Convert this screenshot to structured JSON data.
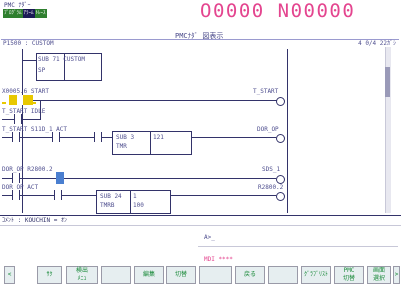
{
  "header": {
    "top_label": "PMC ﾅﾀﾞｰ",
    "tab_a": "ﾌﾟﾛｸﾞﾗﾑ",
    "tab_b": "ｱﾗｰﾑ",
    "tab_c": "ﾄﾚｰｽ",
    "mode_title": "PMCﾅﾀﾞ 図表示",
    "counter": "O0000 N00000"
  },
  "status_bar": {
    "program": "P1500 : CUSTOM",
    "position": "4 0/4 22ｶﾞｼ"
  },
  "ladder": {
    "rung1_func": "SUB 71 CUSTOM",
    "rung1_sub": "SP",
    "rung2_contact": "X0005.6 START",
    "rung2_coil": "T_START",
    "rung3_contact": "T_START IDLE",
    "rung4_contacts": "T_START S11D_1  ACT",
    "rung4_func_a": "SUB 3",
    "rung4_func_b": "TMR",
    "rung4_func_c": "121",
    "rung4_coil": "DOR_OP",
    "rung5_contact": "DOR_OP  R2800.2",
    "rung5_coil": "SDS_1",
    "rung6_contact": "DOR_OP  ACT",
    "rung6_func_a": "SUB 24",
    "rung6_func_b": "TMRB",
    "rung6_func_c": "1",
    "rung6_func_d": "100",
    "rung6_coil": "R2800.2"
  },
  "footer": {
    "comment_line": "ｺﾒﾝﾄ : KOUCHIN = ｵﾝ",
    "input_prompt": "A>_",
    "mode_line": "MDI ****"
  },
  "softkeys": [
    "<",
    "ｻｸ",
    "検出\nﾒﾆｭ",
    "",
    "編集",
    "切替",
    "",
    "戻る",
    "",
    "ｸﾞﾗﾌﾞﾘｽﾄ",
    "PMC\n切替",
    "画面\n選択",
    ">"
  ],
  "colors": {
    "title_pink": "#e4458f",
    "ladder_line": "#33336a",
    "active_contact": "#e8c800",
    "active_block": "#4a7fd0",
    "softkey_text": "#1a8a3a"
  }
}
